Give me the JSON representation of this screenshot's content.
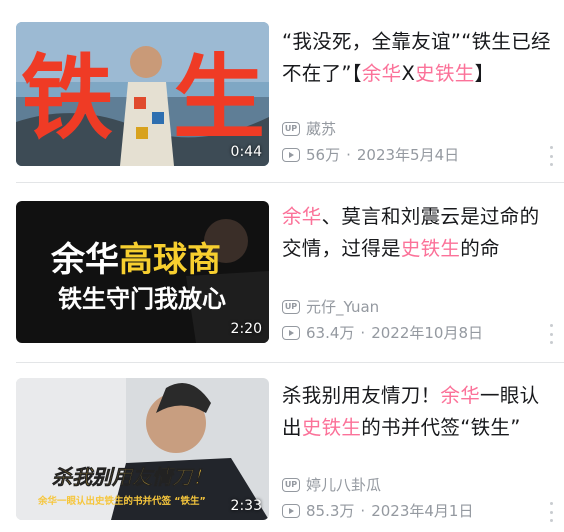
{
  "colors": {
    "highlight": "#fb7299",
    "meta": "#9499a0",
    "title": "#18191c"
  },
  "videos": [
    {
      "thumb_text": "铁生",
      "duration": "0:44",
      "title_parts": [
        {
          "text": "“我没死，全靠友谊”“铁生已经不在了”【",
          "hl": false
        },
        {
          "text": "余华",
          "hl": true
        },
        {
          "text": "X",
          "hl": false
        },
        {
          "text": "史铁生",
          "hl": true
        },
        {
          "text": "】",
          "hl": false
        }
      ],
      "author": "葳苏",
      "views": "56万",
      "date": "2023年5月4日"
    },
    {
      "thumb_line1_a": "余华",
      "thumb_line1_b": "高球商",
      "thumb_line2": "铁生守门我放心",
      "duration": "2:20",
      "title_parts": [
        {
          "text": "余华",
          "hl": true
        },
        {
          "text": "、莫言和刘震云是过命的交情，过得是",
          "hl": false
        },
        {
          "text": "史铁生",
          "hl": true
        },
        {
          "text": "的命",
          "hl": false
        }
      ],
      "author": "元仔_Yuan",
      "views": "63.4万",
      "date": "2022年10月8日"
    },
    {
      "thumb_line1": "杀我别用友情刀！",
      "thumb_line2": "余华一眼认出史铁生的书并代签 “铁生”",
      "duration": "2:33",
      "title_parts": [
        {
          "text": "杀我别用友情刀！",
          "hl": false
        },
        {
          "text": "余华",
          "hl": true
        },
        {
          "text": "一眼认出",
          "hl": false
        },
        {
          "text": "史铁生",
          "hl": true
        },
        {
          "text": "的书并代签“铁生”",
          "hl": false
        }
      ],
      "author": "婷儿八卦瓜",
      "views": "85.3万",
      "date": "2023年4月1日"
    }
  ],
  "icons": {
    "uploader": "up-icon",
    "views": "play-count-icon",
    "menu": "more-vertical-icon"
  },
  "labels": {
    "up_badge": "UP",
    "separator": "·"
  }
}
